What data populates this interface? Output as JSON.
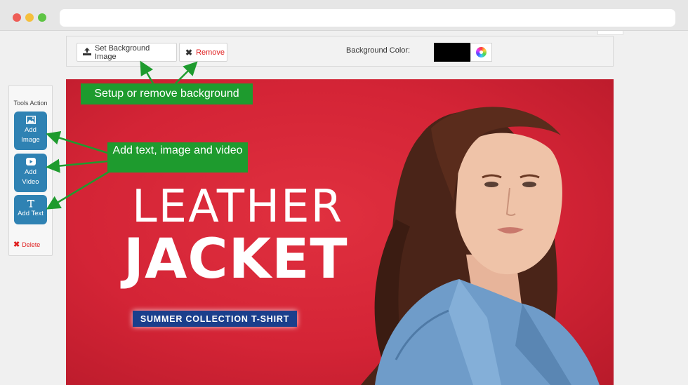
{
  "toolbar": {
    "set_bg_label": "Set Background Image",
    "remove_label": "Remove",
    "bg_color_label": "Background Color:",
    "bg_color_value": "#000000"
  },
  "tools": {
    "title": "Tools Action",
    "add_image": "Add Image",
    "add_video": "Add Video",
    "add_text": "Add Text",
    "delete": "Delete"
  },
  "canvas": {
    "background_color": "#d42436",
    "headline_line1": "LEATHER",
    "headline_line2": "JACKET",
    "badge": "SUMMER COLLECTION T-SHIRT"
  },
  "callouts": {
    "background": "Setup or remove background",
    "add_content": "Add text, image and video"
  },
  "colors": {
    "accent_blue": "#2f82b3",
    "callout_green": "#1e9b2e",
    "delete_red": "#e02020"
  }
}
